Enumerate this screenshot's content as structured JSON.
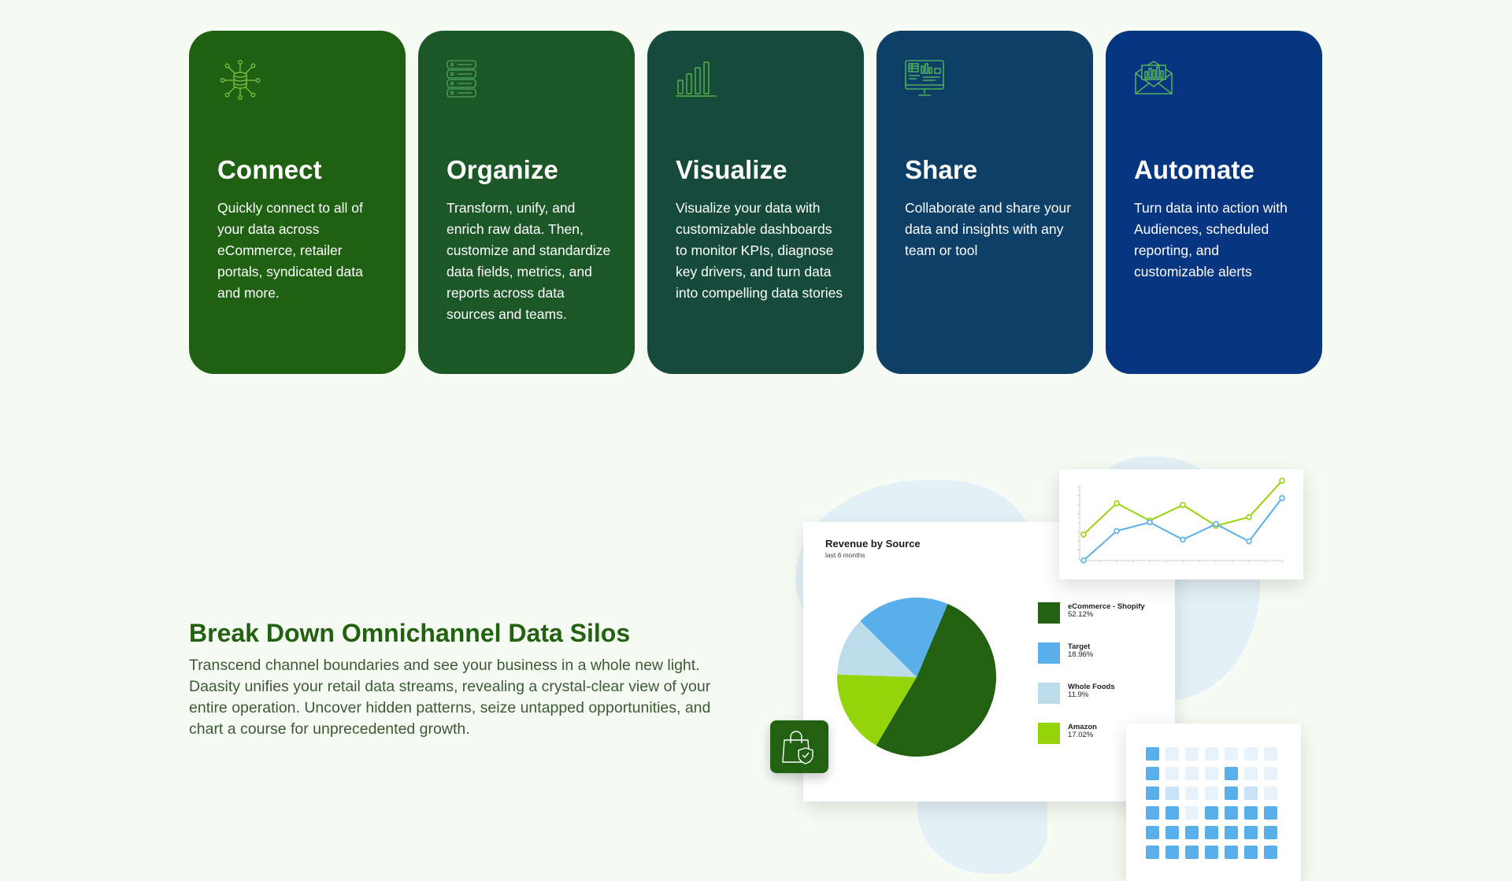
{
  "cards": [
    {
      "key": "connect",
      "icon": "database-network-icon",
      "title": "Connect",
      "bg": "#1f6013",
      "body": "Quickly connect to all of your data across eCommerce, retailer portals, syndicated data and more."
    },
    {
      "key": "organize",
      "icon": "server-stack-icon",
      "title": "Organize",
      "bg": "#1c5728",
      "body": "Transform, unify, and enrich raw data. Then, customize and standardize data fields, metrics, and reports across data sources and teams."
    },
    {
      "key": "visualize",
      "icon": "bar-chart-icon",
      "title": "Visualize",
      "bg": "#164a3b",
      "body": "Visualize your data with customizable dashboards to monitor KPIs, diagnose key drivers, and turn data into compelling data stories"
    },
    {
      "key": "share",
      "icon": "dashboard-monitor-icon",
      "title": "Share",
      "bg": "#0e3f66",
      "body": "Collaborate and share your data and insights with any team or tool"
    },
    {
      "key": "automate",
      "icon": "mail-chart-icon",
      "title": "Automate",
      "bg": "#083580",
      "body": "Turn data into action with Audiences, scheduled reporting, and customizable alerts"
    }
  ],
  "silos": {
    "title": "Break Down Omnichannel Data Silos",
    "body": "Transcend channel boundaries and see your business in a whole new light. Daasity unifies your retail data streams, revealing a crystal-clear view of your entire operation. Uncover hidden patterns, seize untapped opportunities, and chart a course for unprecedented growth."
  },
  "colors": {
    "brand_green": "#226112",
    "accent_lime": "#96d40a",
    "blue": "#59afea",
    "light_blue": "#bcdceb"
  },
  "report": {
    "title": "Revenue by Source",
    "subtitle": "last 6 months",
    "legend": [
      {
        "name": "eCommerce - Shopify",
        "pct": "52.12%",
        "color": "#226112"
      },
      {
        "name": "Target",
        "pct": "18.96%",
        "color": "#59afea"
      },
      {
        "name": "Whole Foods",
        "pct": "11.9%",
        "color": "#bcdceb"
      },
      {
        "name": "Amazon",
        "pct": "17.02%",
        "color": "#96d40a"
      }
    ]
  },
  "line_chart": {
    "series": [
      {
        "color": "#96d40a",
        "values": [
          3.2,
          6.8,
          4.8,
          6.6,
          4.2,
          5.2,
          9.4
        ]
      },
      {
        "color": "#59afea",
        "values": [
          0.2,
          3.6,
          4.6,
          2.6,
          4.4,
          2.4,
          7.4
        ]
      }
    ]
  },
  "grid_levels": [
    [
      3,
      1,
      1,
      1,
      1,
      1,
      1
    ],
    [
      3,
      1,
      1,
      1,
      3,
      1,
      1
    ],
    [
      3,
      2,
      1,
      1,
      3,
      2,
      1
    ],
    [
      3,
      3,
      1,
      3,
      3,
      3,
      3
    ],
    [
      3,
      3,
      3,
      3,
      3,
      3,
      3
    ],
    [
      3,
      3,
      3,
      3,
      3,
      3,
      3
    ]
  ],
  "bag_icon": "shopping-bag-shield-icon"
}
